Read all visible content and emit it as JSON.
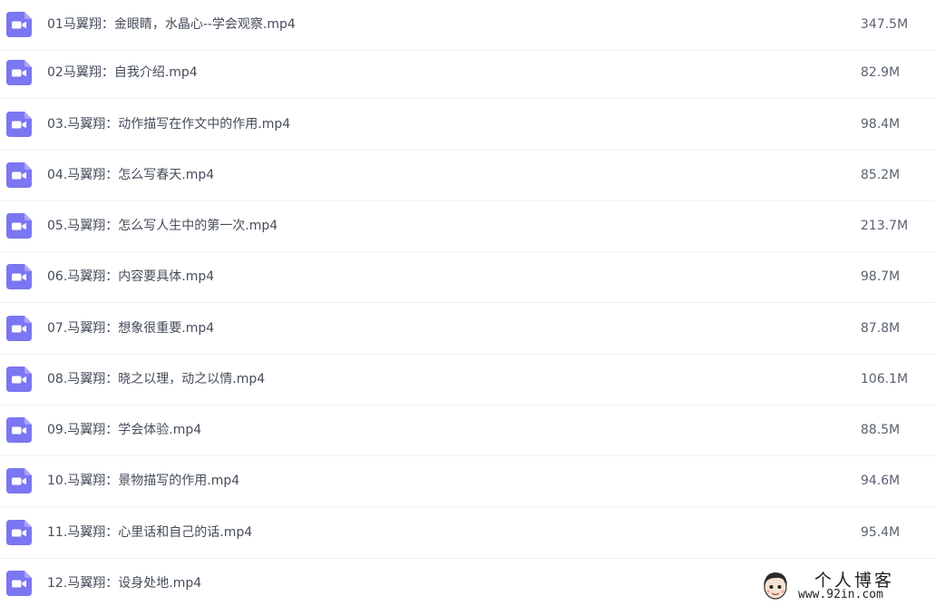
{
  "colors": {
    "icon_background": "#7b76f1",
    "icon_glyph": "#ffffff",
    "row_divider": "#f0f1f4",
    "text": "#454d5a"
  },
  "files": [
    {
      "name": "01马翼翔：金眼睛，水晶心--学会观察.mp4",
      "size": "347.5M",
      "icon": "video-file-icon"
    },
    {
      "name": "02马翼翔：自我介绍.mp4",
      "size": "82.9M",
      "icon": "video-file-icon"
    },
    {
      "name": "03.马翼翔：动作描写在作文中的作用.mp4",
      "size": "98.4M",
      "icon": "video-file-icon"
    },
    {
      "name": "04.马翼翔：怎么写春天.mp4",
      "size": "85.2M",
      "icon": "video-file-icon"
    },
    {
      "name": "05.马翼翔：怎么写人生中的第一次.mp4",
      "size": "213.7M",
      "icon": "video-file-icon"
    },
    {
      "name": "06.马翼翔：内容要具体.mp4",
      "size": "98.7M",
      "icon": "video-file-icon"
    },
    {
      "name": "07.马翼翔：想象很重要.mp4",
      "size": "87.8M",
      "icon": "video-file-icon"
    },
    {
      "name": "08.马翼翔：晓之以理，动之以情.mp4",
      "size": "106.1M",
      "icon": "video-file-icon"
    },
    {
      "name": "09.马翼翔：学会体验.mp4",
      "size": "88.5M",
      "icon": "video-file-icon"
    },
    {
      "name": "10.马翼翔：景物描写的作用.mp4",
      "size": "94.6M",
      "icon": "video-file-icon"
    },
    {
      "name": "11.马翼翔：心里话和自己的话.mp4",
      "size": "95.4M",
      "icon": "video-file-icon"
    },
    {
      "name": "12.马翼翔：设身处地.mp4",
      "size": "",
      "icon": "video-file-icon"
    }
  ],
  "watermark": {
    "title": "个人博客",
    "url": "www.92in.com"
  }
}
